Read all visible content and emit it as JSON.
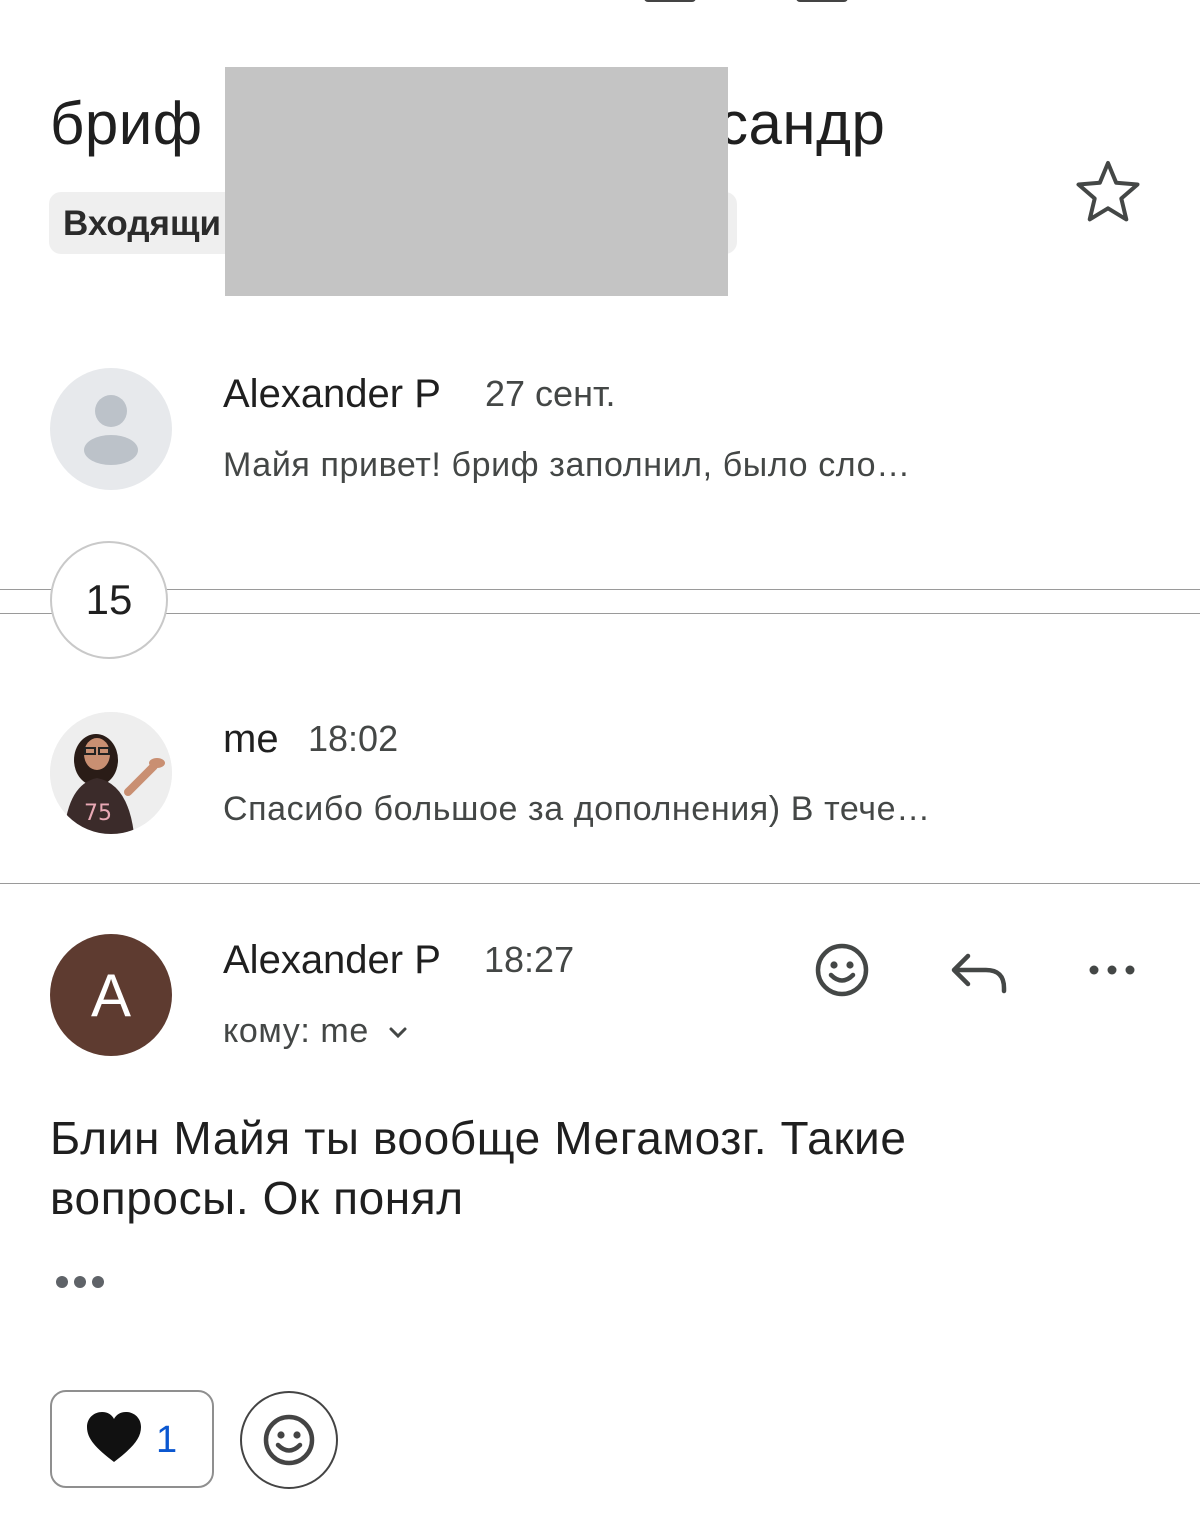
{
  "thread": {
    "subject_visible_start": "бриф",
    "subject_visible_end": "сандр",
    "label": "Входящи",
    "star_icon": "star-outline-icon"
  },
  "messages": [
    {
      "sender": "Alexander P",
      "time": "27 сент.",
      "snippet": "Майя привет! бриф заполнил, было сло…",
      "avatar": "person-placeholder-icon"
    },
    {
      "collapsed_count": "15"
    },
    {
      "sender": "me",
      "time": "18:02",
      "snippet": "Спасибо большое за дополнения) В тече…",
      "avatar": "user-photo"
    }
  ],
  "open_message": {
    "avatar_letter": "A",
    "avatar_color": "#5e3b30",
    "sender": "Alexander P",
    "time": "18:27",
    "recipients": "кому: me",
    "body": "Блин Майя ты вообще Мегамозг. Такие вопросы. Ок понял",
    "actions": [
      "add-emoji-reaction-icon",
      "reply-icon",
      "more-options-icon"
    ],
    "reactions": [
      {
        "emoji": "🖤",
        "count": "1"
      }
    ]
  },
  "colors": {
    "text_primary": "#1f1f1f",
    "text_secondary": "#444746",
    "reaction_count": "#0b57d0",
    "redaction": "#c4c4c4"
  }
}
